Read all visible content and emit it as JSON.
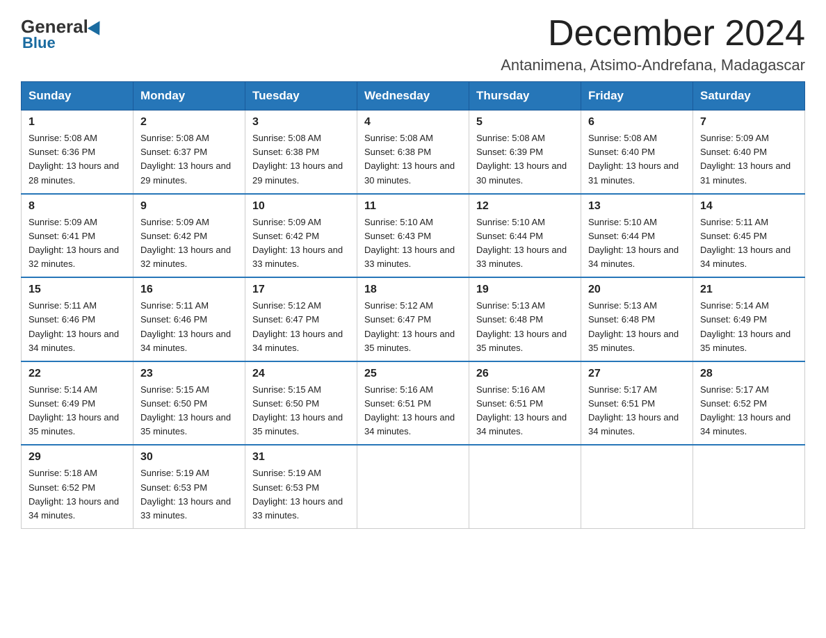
{
  "logo": {
    "general": "General",
    "blue": "Blue"
  },
  "header": {
    "title": "December 2024",
    "location": "Antanimena, Atsimo-Andrefana, Madagascar"
  },
  "weekdays": [
    "Sunday",
    "Monday",
    "Tuesday",
    "Wednesday",
    "Thursday",
    "Friday",
    "Saturday"
  ],
  "weeks": [
    [
      {
        "day": 1,
        "sunrise": "5:08 AM",
        "sunset": "6:36 PM",
        "daylight": "13 hours and 28 minutes"
      },
      {
        "day": 2,
        "sunrise": "5:08 AM",
        "sunset": "6:37 PM",
        "daylight": "13 hours and 29 minutes"
      },
      {
        "day": 3,
        "sunrise": "5:08 AM",
        "sunset": "6:38 PM",
        "daylight": "13 hours and 29 minutes"
      },
      {
        "day": 4,
        "sunrise": "5:08 AM",
        "sunset": "6:38 PM",
        "daylight": "13 hours and 30 minutes"
      },
      {
        "day": 5,
        "sunrise": "5:08 AM",
        "sunset": "6:39 PM",
        "daylight": "13 hours and 30 minutes"
      },
      {
        "day": 6,
        "sunrise": "5:08 AM",
        "sunset": "6:40 PM",
        "daylight": "13 hours and 31 minutes"
      },
      {
        "day": 7,
        "sunrise": "5:09 AM",
        "sunset": "6:40 PM",
        "daylight": "13 hours and 31 minutes"
      }
    ],
    [
      {
        "day": 8,
        "sunrise": "5:09 AM",
        "sunset": "6:41 PM",
        "daylight": "13 hours and 32 minutes"
      },
      {
        "day": 9,
        "sunrise": "5:09 AM",
        "sunset": "6:42 PM",
        "daylight": "13 hours and 32 minutes"
      },
      {
        "day": 10,
        "sunrise": "5:09 AM",
        "sunset": "6:42 PM",
        "daylight": "13 hours and 33 minutes"
      },
      {
        "day": 11,
        "sunrise": "5:10 AM",
        "sunset": "6:43 PM",
        "daylight": "13 hours and 33 minutes"
      },
      {
        "day": 12,
        "sunrise": "5:10 AM",
        "sunset": "6:44 PM",
        "daylight": "13 hours and 33 minutes"
      },
      {
        "day": 13,
        "sunrise": "5:10 AM",
        "sunset": "6:44 PM",
        "daylight": "13 hours and 34 minutes"
      },
      {
        "day": 14,
        "sunrise": "5:11 AM",
        "sunset": "6:45 PM",
        "daylight": "13 hours and 34 minutes"
      }
    ],
    [
      {
        "day": 15,
        "sunrise": "5:11 AM",
        "sunset": "6:46 PM",
        "daylight": "13 hours and 34 minutes"
      },
      {
        "day": 16,
        "sunrise": "5:11 AM",
        "sunset": "6:46 PM",
        "daylight": "13 hours and 34 minutes"
      },
      {
        "day": 17,
        "sunrise": "5:12 AM",
        "sunset": "6:47 PM",
        "daylight": "13 hours and 34 minutes"
      },
      {
        "day": 18,
        "sunrise": "5:12 AM",
        "sunset": "6:47 PM",
        "daylight": "13 hours and 35 minutes"
      },
      {
        "day": 19,
        "sunrise": "5:13 AM",
        "sunset": "6:48 PM",
        "daylight": "13 hours and 35 minutes"
      },
      {
        "day": 20,
        "sunrise": "5:13 AM",
        "sunset": "6:48 PM",
        "daylight": "13 hours and 35 minutes"
      },
      {
        "day": 21,
        "sunrise": "5:14 AM",
        "sunset": "6:49 PM",
        "daylight": "13 hours and 35 minutes"
      }
    ],
    [
      {
        "day": 22,
        "sunrise": "5:14 AM",
        "sunset": "6:49 PM",
        "daylight": "13 hours and 35 minutes"
      },
      {
        "day": 23,
        "sunrise": "5:15 AM",
        "sunset": "6:50 PM",
        "daylight": "13 hours and 35 minutes"
      },
      {
        "day": 24,
        "sunrise": "5:15 AM",
        "sunset": "6:50 PM",
        "daylight": "13 hours and 35 minutes"
      },
      {
        "day": 25,
        "sunrise": "5:16 AM",
        "sunset": "6:51 PM",
        "daylight": "13 hours and 34 minutes"
      },
      {
        "day": 26,
        "sunrise": "5:16 AM",
        "sunset": "6:51 PM",
        "daylight": "13 hours and 34 minutes"
      },
      {
        "day": 27,
        "sunrise": "5:17 AM",
        "sunset": "6:51 PM",
        "daylight": "13 hours and 34 minutes"
      },
      {
        "day": 28,
        "sunrise": "5:17 AM",
        "sunset": "6:52 PM",
        "daylight": "13 hours and 34 minutes"
      }
    ],
    [
      {
        "day": 29,
        "sunrise": "5:18 AM",
        "sunset": "6:52 PM",
        "daylight": "13 hours and 34 minutes"
      },
      {
        "day": 30,
        "sunrise": "5:19 AM",
        "sunset": "6:53 PM",
        "daylight": "13 hours and 33 minutes"
      },
      {
        "day": 31,
        "sunrise": "5:19 AM",
        "sunset": "6:53 PM",
        "daylight": "13 hours and 33 minutes"
      },
      null,
      null,
      null,
      null
    ]
  ]
}
